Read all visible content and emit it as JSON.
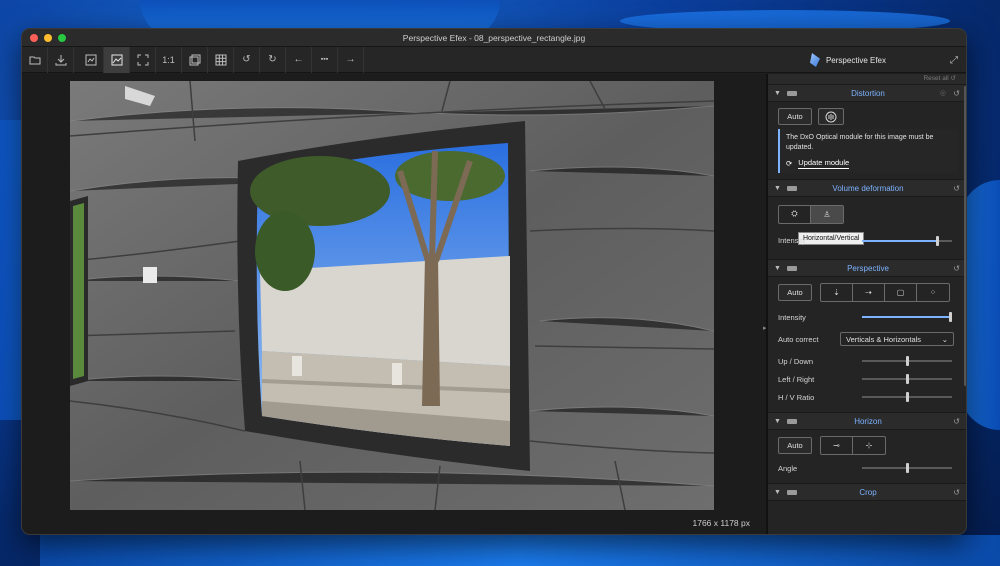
{
  "window": {
    "title": "Perspective Efex - 08_perspective_rectangle.jpg"
  },
  "toolbar": {
    "buttons": [
      {
        "name": "open-folder-icon",
        "glyph": "▭"
      },
      {
        "name": "export-icon",
        "glyph": "⤓"
      },
      {
        "name": "compare-icon",
        "glyph": "◫"
      },
      {
        "name": "single-view-icon",
        "glyph": "▣"
      },
      {
        "name": "fit-icon",
        "glyph": "⤢"
      },
      {
        "name": "zoom-100-icon",
        "glyph": "1:1"
      },
      {
        "name": "preview-icon",
        "glyph": "⧉"
      },
      {
        "name": "grid-icon",
        "glyph": "▦"
      },
      {
        "name": "undo-icon",
        "glyph": "↺"
      },
      {
        "name": "redo-icon",
        "glyph": "↻"
      },
      {
        "name": "previous-icon",
        "glyph": "←"
      },
      {
        "name": "filmstrip-icon",
        "glyph": "▪▪▪"
      },
      {
        "name": "next-icon",
        "glyph": "→"
      }
    ],
    "brand": "Perspective Efex"
  },
  "canvas": {
    "image_size": "1766 x 1178 px"
  },
  "panel": {
    "reset_all": "Reset all",
    "distortion": {
      "title": "Distortion",
      "auto_label": "Auto",
      "notice": "The DxO Optical module for this image must be updated.",
      "update_label": "Update module"
    },
    "volume": {
      "title": "Volume deformation",
      "tooltip": "Horizontal/Vertical",
      "intensity_label": "Intensity",
      "intensity_value": 0.85
    },
    "perspective": {
      "title": "Perspective",
      "auto_label": "Auto",
      "intensity_label": "Intensity",
      "intensity_value": 1.0,
      "auto_correct_label": "Auto correct",
      "auto_correct_value": "Verticals & Horizontals",
      "updown_label": "Up / Down",
      "leftright_label": "Left / Right",
      "hv_label": "H / V Ratio"
    },
    "horizon": {
      "title": "Horizon",
      "auto_label": "Auto",
      "angle_label": "Angle"
    },
    "crop": {
      "title": "Crop"
    }
  }
}
